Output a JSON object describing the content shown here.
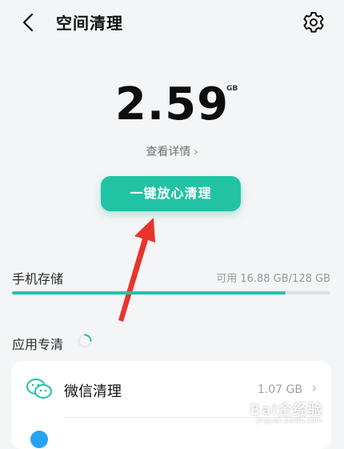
{
  "header": {
    "title": "空间清理",
    "back_icon": "chevron-left-icon",
    "settings_icon": "gear-icon"
  },
  "storage_summary": {
    "amount": "2.59",
    "unit": "GB",
    "details_link": "查看详情"
  },
  "clean_button": {
    "label": "一键放心清理"
  },
  "phone_storage": {
    "label": "手机存储",
    "available_text": "可用 16.88 GB/128 GB",
    "fill_fraction": 0.86
  },
  "app_cleaning": {
    "label": "应用专清",
    "items": [
      {
        "label": "微信清理",
        "size": "1.07 GB",
        "icon": "wechat-icon"
      }
    ]
  },
  "watermark": {
    "text": "Bai企经验",
    "sub": "jingyan.baidu.com"
  },
  "colors": {
    "accent": "#22c3a5",
    "annotation_arrow": "#e8352b"
  }
}
